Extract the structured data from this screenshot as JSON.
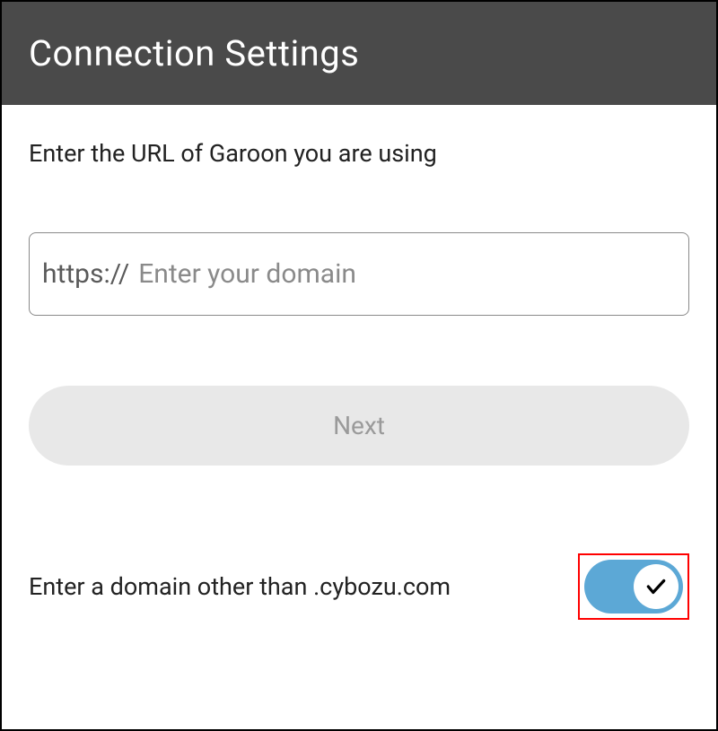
{
  "header": {
    "title": "Connection Settings"
  },
  "main": {
    "instruction": "Enter the URL of Garoon you are using",
    "url_prefix": "https://",
    "url_placeholder": "Enter your domain",
    "url_value": "",
    "next_button_label": "Next",
    "toggle_label": "Enter a domain other than .cybozu.com",
    "toggle_on": true
  },
  "colors": {
    "header_bg": "#4a4a4a",
    "toggle_on_bg": "#5ca8d6",
    "highlight_border": "#ff0000"
  }
}
